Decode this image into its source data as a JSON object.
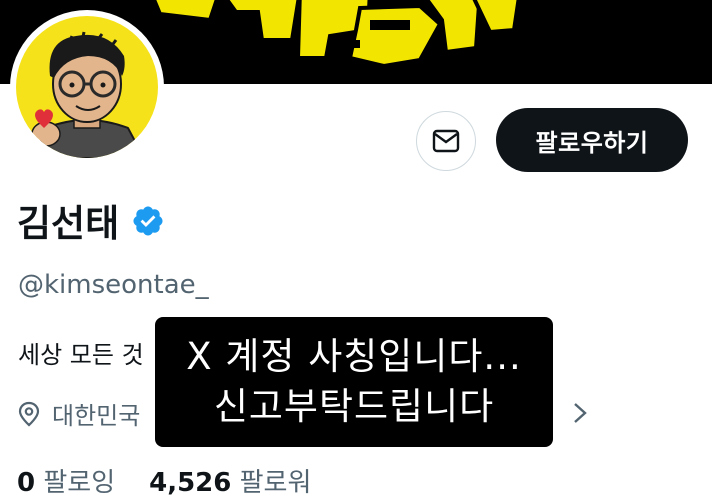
{
  "profile": {
    "display_name": "김선태",
    "handle": "@kimseontae_",
    "bio": "세상 모든 것",
    "location": "대한민국",
    "following_count": "0",
    "following_label": "팔로잉",
    "followers_count": "4,526",
    "followers_label": "팔로워"
  },
  "actions": {
    "follow_label": "팔로우하기",
    "message_icon": "envelope-icon"
  },
  "overlay": {
    "line1": "X 계정 사칭입니다...",
    "line2": "신고부탁드립니다"
  },
  "colors": {
    "banner_bg": "#000000",
    "banner_text": "#f2e600",
    "avatar_bg": "#f5e21a",
    "verified_blue": "#1d9bf0",
    "secondary_text": "#536471",
    "primary_text": "#0f1419"
  }
}
